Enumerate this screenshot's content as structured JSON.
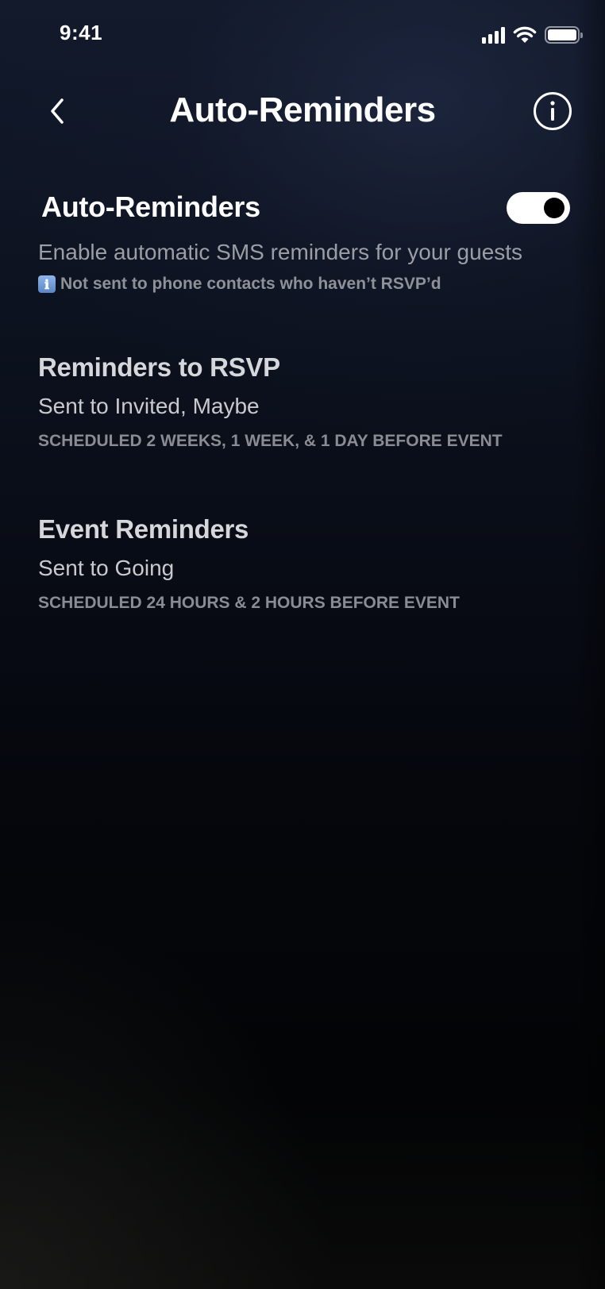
{
  "status_bar": {
    "time": "9:41",
    "icons": [
      "signal-icon",
      "wifi-icon",
      "battery-icon"
    ]
  },
  "nav": {
    "title": "Auto-Reminders",
    "back_icon": "chevron-left-icon",
    "info_icon": "info-icon"
  },
  "auto_reminders": {
    "title": "Auto-Reminders",
    "enabled": true,
    "subtitle": "Enable automatic SMS reminders for your guests",
    "note_icon": "ℹ",
    "note": "Not sent to phone contacts who haven’t RSVP’d"
  },
  "sections": [
    {
      "title": "Reminders to RSVP",
      "subtitle": "Sent to Invited, Maybe",
      "schedule": "SCHEDULED 2 WEEKS, 1 WEEK, & 1 DAY BEFORE EVENT"
    },
    {
      "title": "Event Reminders",
      "subtitle": "Sent to Going",
      "schedule": "SCHEDULED 24 HOURS & 2 HOURS BEFORE EVENT"
    }
  ],
  "colors": {
    "background": "#0b101c",
    "text_primary": "#ffffff",
    "text_secondary": "#9c9ea6",
    "text_muted": "#8a8c93",
    "toggle_on": "#ffffff"
  }
}
